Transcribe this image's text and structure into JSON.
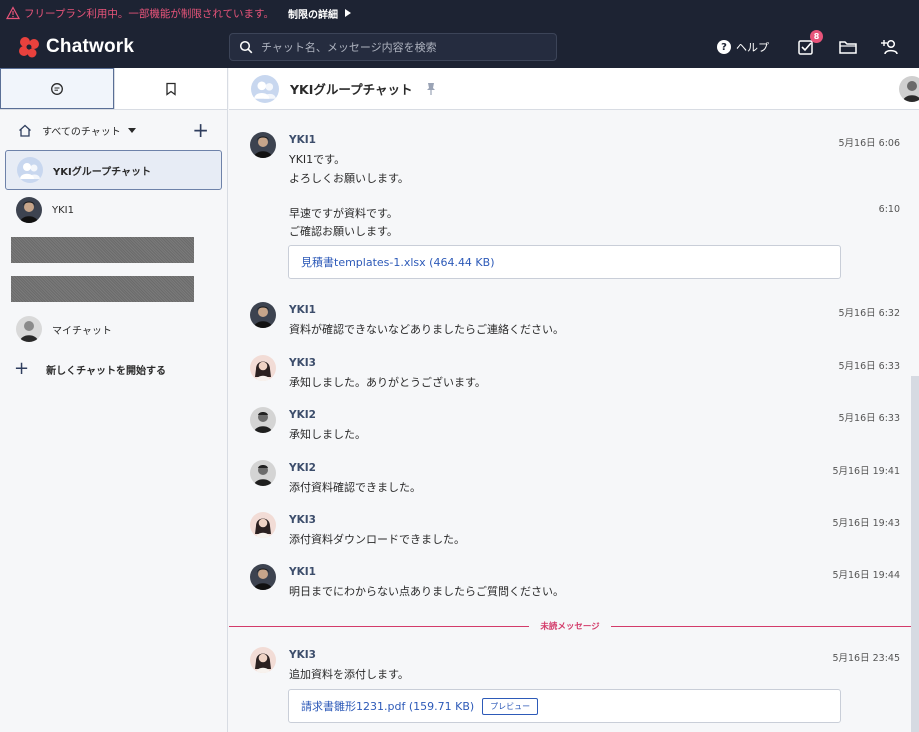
{
  "warning": {
    "text": "フリープラン利用中。一部機能が制限されています。",
    "detail_label": "制限の詳細"
  },
  "header": {
    "logo_text": "Chatwork",
    "search_placeholder": "チャット名、メッセージ内容を検索",
    "help_label": "ヘルプ",
    "task_badge": "8"
  },
  "sidebar": {
    "filter_label": "すべてのチャット",
    "rooms": [
      {
        "name": "YKIグループチャット",
        "active": true
      },
      {
        "name": "YKI1"
      },
      {
        "name": "マイチャット"
      }
    ],
    "new_chat_label": "新しくチャットを開始する"
  },
  "chat": {
    "title": "YKIグループチャット",
    "messages": [
      {
        "user": "YKI1",
        "time": "5月16日 6:06",
        "lines": [
          "YKI1です。",
          "よろしくお願いします。"
        ]
      },
      {
        "user": "",
        "time": "6:10",
        "lines": [
          "早速ですが資料です。",
          "ご確認お願いします。"
        ],
        "file": "見積書templates-1.xlsx (464.44 KB)"
      },
      {
        "user": "YKI1",
        "time": "5月16日 6:32",
        "lines": [
          "資料が確認できないなどありましたらご連絡ください。"
        ]
      },
      {
        "user": "YKI3",
        "time": "5月16日 6:33",
        "lines": [
          "承知しました。ありがとうございます。"
        ]
      },
      {
        "user": "YKI2",
        "time": "5月16日 6:33",
        "lines": [
          "承知しました。"
        ]
      },
      {
        "user": "YKI2",
        "time": "5月16日 19:41",
        "lines": [
          "添付資料確認できました。"
        ]
      },
      {
        "user": "YKI3",
        "time": "5月16日 19:43",
        "lines": [
          "添付資料ダウンロードできました。"
        ]
      },
      {
        "user": "YKI1",
        "time": "5月16日 19:44",
        "lines": [
          "明日までにわからない点ありましたらご質問ください。"
        ]
      },
      {
        "user": "YKI3",
        "time": "5月16日 23:45",
        "lines": [
          "追加資料を添付します。"
        ],
        "file": "請求書雛形1231.pdf (159.71 KB)",
        "preview_label": "プレビュー"
      }
    ],
    "unread_label": "未読メッセージ"
  },
  "colors": {
    "header_bg": "#1d2333",
    "warning_text": "#e8547a",
    "link": "#2d5ab8",
    "unread": "#d33b6a",
    "username": "#3c4d6b"
  }
}
